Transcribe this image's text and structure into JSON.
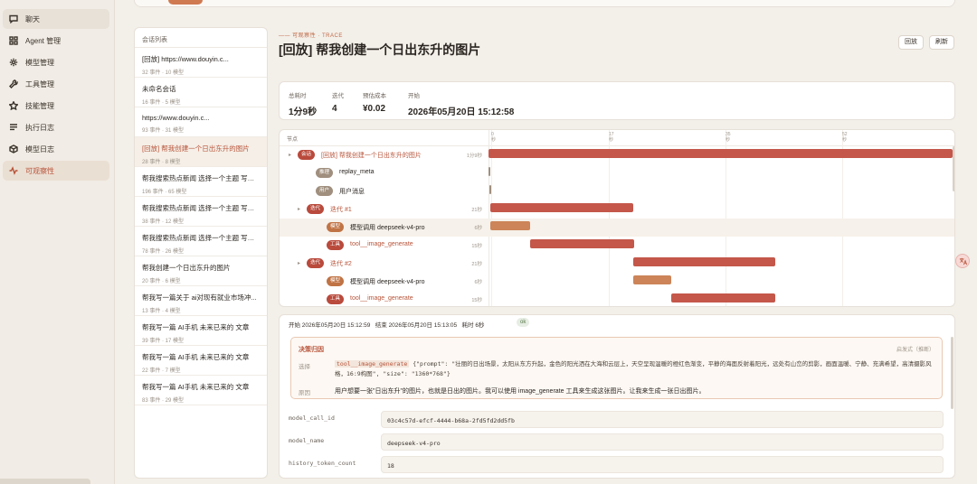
{
  "nav": {
    "items": [
      {
        "label": "聊天",
        "icon": "chat-icon"
      },
      {
        "label": "Agent 管理",
        "icon": "grid-icon"
      },
      {
        "label": "模型管理",
        "icon": "gear-icon"
      },
      {
        "label": "工具管理",
        "icon": "wrench-icon"
      },
      {
        "label": "技能管理",
        "icon": "star-icon"
      },
      {
        "label": "执行日志",
        "icon": "list-icon"
      },
      {
        "label": "模型日志",
        "icon": "cube-icon"
      },
      {
        "label": "可观察性",
        "icon": "pulse-icon"
      }
    ]
  },
  "sessions": {
    "heading": "会话列表",
    "items": [
      {
        "title": "[回放] https://www.douyin.c...",
        "meta": "32 事件 · 10 模型"
      },
      {
        "title": "未命名会话",
        "meta": "16 事件 · 5 模型"
      },
      {
        "title": "https://www.douyin.c...",
        "meta": "93 事件 · 31 模型"
      },
      {
        "title": "[回放] 帮我创建一个日出东升的图片",
        "meta": "28 事件 · 8 模型"
      },
      {
        "title": "帮我搜索热点新闻 选择一个主题 写一...",
        "meta": "196 事件 · 65 模型"
      },
      {
        "title": "帮我搜索热点新闻 选择一个主题 写一...",
        "meta": "38 事件 · 12 模型"
      },
      {
        "title": "帮我搜索热点新闻 选择一个主题 写一...",
        "meta": "78 事件 · 26 模型"
      },
      {
        "title": "帮我创建一个日出东升的图片",
        "meta": "20 事件 · 6 模型"
      },
      {
        "title": "帮我写一篇关于 ai对现有就业市场冲...",
        "meta": "13 事件 · 4 模型"
      },
      {
        "title": "帮我写一篇 AI手机 未来已来的 文章",
        "meta": "39 事件 · 17 模型"
      },
      {
        "title": "帮我写一篇 AI手机 未来已来的 文章",
        "meta": "22 事件 · 7 模型"
      },
      {
        "title": "帮我写一篇 AI手机 未来已来的 文章",
        "meta": "83 事件 · 29 模型"
      }
    ]
  },
  "header": {
    "tag": "—— 可观察性 · TRACE",
    "title": "[回放] 帮我创建一个日出东升的图片",
    "replay_btn": "回放",
    "refresh_btn": "刷新"
  },
  "stats": [
    {
      "label": "总耗时",
      "value": "1分9秒"
    },
    {
      "label": "迭代",
      "value": "4"
    },
    {
      "label": "预估成本",
      "value": "¥0.02"
    },
    {
      "label": "开始",
      "value": "2026年05月20日 15:12:58"
    }
  ],
  "timeline": {
    "nodes_label": "节点",
    "ticks": [
      [
        "0",
        "秒"
      ],
      [
        "17",
        "秒"
      ],
      [
        "35",
        "秒"
      ],
      [
        "52",
        "秒"
      ]
    ],
    "rows": [
      {
        "badge": "会话",
        "label": "[回放] 帮我创建一个日出东升的图片",
        "duration": "1分9秒"
      },
      {
        "badge": "推理",
        "label": "replay_meta",
        "duration": ""
      },
      {
        "badge": "用户",
        "label": "用户消息",
        "duration": ""
      },
      {
        "badge": "迭代",
        "label": "迭代 #1",
        "duration": "21秒"
      },
      {
        "badge": "模型",
        "label": "模型调用 deepseek-v4-pro",
        "duration": "6秒"
      },
      {
        "badge": "工具",
        "label": "tool__image_generate",
        "duration": "15秒"
      },
      {
        "badge": "迭代",
        "label": "迭代 #2",
        "duration": "21秒"
      },
      {
        "badge": "模型",
        "label": "模型调用 deepseek-v4-pro",
        "duration": "6秒"
      },
      {
        "badge": "工具",
        "label": "tool__image_generate",
        "duration": "15秒"
      }
    ]
  },
  "details": {
    "start_label": "开始 2026年05月20日 15:12:59",
    "end_label": "结束 2026年05月20日 15:13:05",
    "took_label": "耗时 6秒",
    "status": "ok",
    "decision_title": "决策归因",
    "decision_right": "启发式（推断）",
    "select_key": "选择",
    "select_tool": "tool__image_generate",
    "select_args": " {\"prompt\": \"壮丽的日出场景，太阳从东方升起，金色的阳光洒在大海和云层上，天空呈现温暖的橙红色渐变，平静的海面反射着阳光，远处有山峦的剪影，画面温暖、宁静、充满希望，高清摄影风格，16:9构图\", \"size\": \"1360*768\"}",
    "reason_key": "原因",
    "reason_text": "用户想要一张\"日出东升\"的图片，也就是日出的图片。我可以使用 image_generate 工具来生成这张图片。让我来生成一张日出图片。",
    "kv": [
      {
        "key": "model_call_id",
        "value": "03c4c57d-efcf-4444-b68a-2fd5fd2dd5fb"
      },
      {
        "key": "model_name",
        "value": "deepseek-v4-pro"
      },
      {
        "key": "history_token_count",
        "value": "18"
      }
    ]
  },
  "colors": {
    "accent": "#b8543a",
    "bar_main": "#c4574a",
    "bar_model": "#cc8458",
    "badge_session": "#b94a3c",
    "badge_reason": "#a08f7e",
    "badge_user": "#a08f7e",
    "badge_iter": "#b94a3c",
    "badge_model": "#c07344",
    "badge_tool": "#b94a3c"
  }
}
